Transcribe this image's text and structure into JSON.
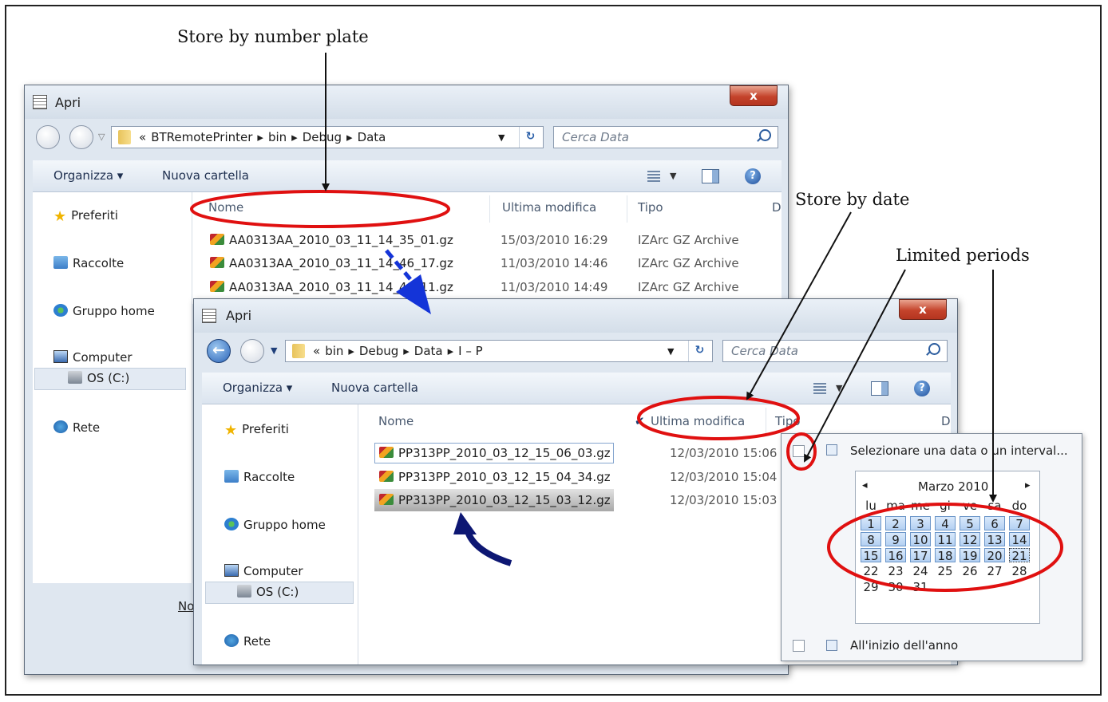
{
  "annotations": {
    "number_plate": "Store by number plate",
    "by_date": "Store by date",
    "limited_periods": "Limited periods"
  },
  "window_back": {
    "title": "Apri",
    "close": "x",
    "breadcrumb": [
      "«",
      "BTRemotePrinter",
      "▸",
      "bin",
      "▸",
      "Debug",
      "▸",
      "Data"
    ],
    "search_placeholder": "Cerca Data",
    "organize": "Organizza ▾",
    "new_folder": "Nuova cartella",
    "nav": [
      "Preferiti",
      "Raccolte",
      "Gruppo home",
      "Computer",
      "OS (C:)",
      "Rete"
    ],
    "columns": {
      "name": "Nome",
      "modified": "Ultima modifica",
      "type": "Tipo",
      "extra": "D"
    },
    "files": [
      {
        "name": "AA0313AA_2010_03_11_14_35_01.gz",
        "modified": "15/03/2010 16:29",
        "type": "IZArc GZ Archive"
      },
      {
        "name": "AA0313AA_2010_03_11_14_46_17.gz",
        "modified": "11/03/2010 14:46",
        "type": "IZArc GZ Archive"
      },
      {
        "name": "AA0313AA_2010_03_11_14_49_11.gz",
        "modified": "11/03/2010 14:49",
        "type": "IZArc GZ Archive"
      }
    ],
    "bottom_partial": "No"
  },
  "window_front": {
    "title": "Apri",
    "close": "x",
    "breadcrumb": [
      "«",
      "bin",
      "▸",
      "Debug",
      "▸",
      "Data",
      "▸",
      "I – P"
    ],
    "search_placeholder": "Cerca Data",
    "organize": "Organizza ▾",
    "new_folder": "Nuova cartella",
    "nav": [
      "Preferiti",
      "Raccolte",
      "Gruppo home",
      "Computer",
      "OS (C:)",
      "Rete"
    ],
    "columns": {
      "name": "Nome",
      "check": "✔",
      "modified": "Ultima modifica",
      "type": "Tipo",
      "extra": "D"
    },
    "files": [
      {
        "name": "PP313PP_2010_03_12_15_06_03.gz",
        "modified": "12/03/2010 15:06"
      },
      {
        "name": "PP313PP_2010_03_12_15_04_34.gz",
        "modified": "12/03/2010 15:04"
      },
      {
        "name": "PP313PP_2010_03_12_15_03_12.gz",
        "modified": "12/03/2010 15:03"
      }
    ]
  },
  "date_popup": {
    "option_top": "Selezionare una data o un interval...",
    "option_bottom": "All'inizio dell'anno",
    "calendar": {
      "month": "Marzo 2010",
      "prev": "◂",
      "next": "▸",
      "weekdays": [
        "lu",
        "ma",
        "me",
        "gi",
        "ve",
        "sa",
        "do"
      ],
      "weeks": [
        [
          "1",
          "2",
          "3",
          "4",
          "5",
          "6",
          "7"
        ],
        [
          "8",
          "9",
          "10",
          "11",
          "12",
          "13",
          "14"
        ],
        [
          "15",
          "16",
          "17",
          "18",
          "19",
          "20",
          "21"
        ],
        [
          "22",
          "23",
          "24",
          "25",
          "26",
          "27",
          "28"
        ],
        [
          "29",
          "30",
          "31",
          "",
          "",
          "",
          ""
        ]
      ],
      "selected_through": "21",
      "today": "21"
    }
  },
  "colors": {
    "highlight_ellipse": "#e01010",
    "arrow_blue": "#1434d8",
    "arrow_navy": "#0d1773"
  }
}
